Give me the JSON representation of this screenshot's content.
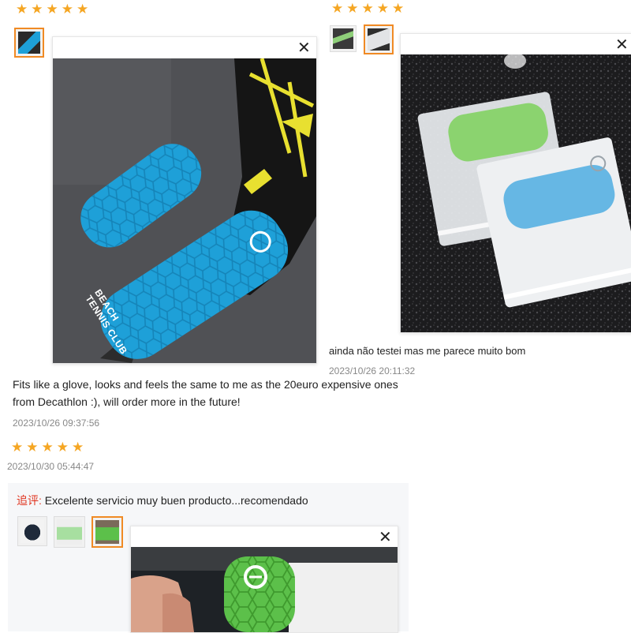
{
  "colors": {
    "star": "#f5a623",
    "thumb_active": "#f08a24",
    "followup_label": "#e0331e"
  },
  "icons": {
    "star": "star-icon",
    "close": "close-icon"
  },
  "review_1": {
    "rating": 5,
    "text": "Fits like a glove, looks and feels the same to me as the 20euro expensive ones from Decathlon :), will order more in the future!",
    "timestamp": "2023/10/26 09:37:56",
    "photo_text": {
      "line1": "BEACH",
      "line2": "TENNIS CLUB"
    }
  },
  "review_2": {
    "rating": 5,
    "text": "ainda não testei mas me parece muito bom",
    "timestamp": "2023/10/26 20:11:32"
  },
  "review_3": {
    "rating": 5,
    "timestamp": "2023/10/30 05:44:47",
    "followup_label": "追评:",
    "followup_text": "Excelente servicio muy buen producto...recomendado"
  }
}
